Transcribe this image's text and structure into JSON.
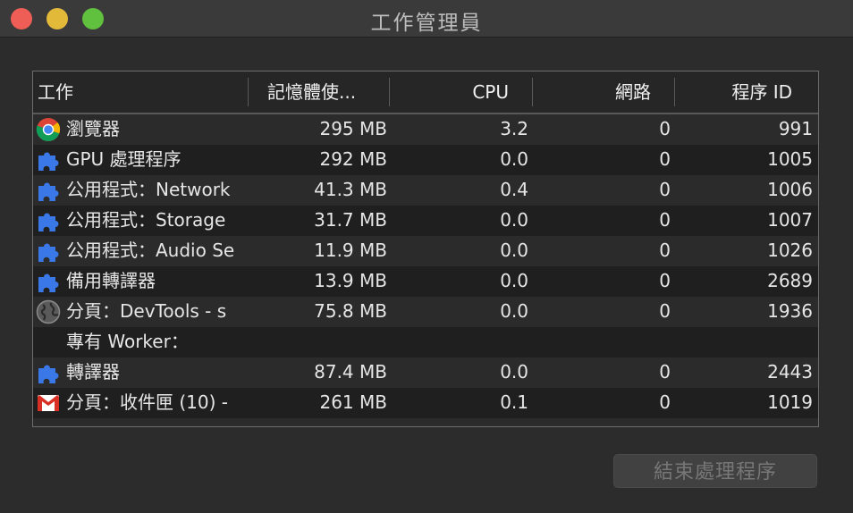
{
  "window": {
    "title": "工作管理員"
  },
  "table": {
    "columns": [
      "工作",
      "記憶體使...",
      "CPU",
      "網路",
      "程序 ID"
    ],
    "rows": [
      {
        "icon": "chrome-icon",
        "name": "瀏覽器",
        "memory": "295 MB",
        "cpu": "3.2",
        "network": "0",
        "pid": "991"
      },
      {
        "icon": "puzzle-extension-icon",
        "name": "GPU 處理程序",
        "memory": "292 MB",
        "cpu": "0.0",
        "network": "0",
        "pid": "1005"
      },
      {
        "icon": "puzzle-extension-icon",
        "name": "公用程式：Network",
        "memory": "41.3 MB",
        "cpu": "0.4",
        "network": "0",
        "pid": "1006"
      },
      {
        "icon": "puzzle-extension-icon",
        "name": "公用程式：Storage",
        "memory": "31.7 MB",
        "cpu": "0.0",
        "network": "0",
        "pid": "1007"
      },
      {
        "icon": "puzzle-extension-icon",
        "name": "公用程式：Audio Se",
        "memory": "11.9 MB",
        "cpu": "0.0",
        "network": "0",
        "pid": "1026"
      },
      {
        "icon": "puzzle-extension-icon",
        "name": "備用轉譯器",
        "memory": "13.9 MB",
        "cpu": "0.0",
        "network": "0",
        "pid": "2689"
      },
      {
        "icon": "globe-icon",
        "name": "分頁：DevTools - s",
        "memory": "75.8 MB",
        "cpu": "0.0",
        "network": "0",
        "pid": "1936"
      },
      {
        "icon": "",
        "name": "專有 Worker：",
        "memory": "",
        "cpu": "",
        "network": "",
        "pid": ""
      },
      {
        "icon": "puzzle-extension-icon",
        "name": "轉譯器",
        "memory": "87.4 MB",
        "cpu": "0.0",
        "network": "0",
        "pid": "2443"
      },
      {
        "icon": "gmail-icon",
        "name": "分頁：收件匣 (10) -",
        "memory": "261 MB",
        "cpu": "0.1",
        "network": "0",
        "pid": "1019"
      }
    ]
  },
  "footer": {
    "end_process_label": "結束處理程序"
  }
}
